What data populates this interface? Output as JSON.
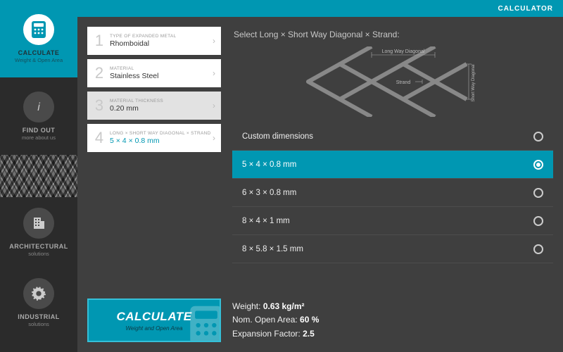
{
  "header": {
    "title": "CALCULATOR"
  },
  "sidebar": {
    "items": [
      {
        "title": "CALCULATE",
        "sub": "Weight & Open Area"
      },
      {
        "title": "FIND OUT",
        "sub": "more about us"
      },
      {
        "title": "ARCHITECTURAL",
        "sub": "solutions"
      },
      {
        "title": "INDUSTRIAL",
        "sub": "solutions"
      }
    ]
  },
  "steps": [
    {
      "num": "1",
      "label": "TYPE OF EXPANDED METAL",
      "value": "Rhomboidal"
    },
    {
      "num": "2",
      "label": "MATERIAL",
      "value": "Stainless Steel"
    },
    {
      "num": "3",
      "label": "MATERIAL THICKNESS",
      "value": "0.20 mm"
    },
    {
      "num": "4",
      "label": "LONG × SHORT WAY DIAGONAL × STRAND",
      "value": "5 × 4 × 0.8 mm"
    }
  ],
  "panel": {
    "title": "Select Long × Short Way Diagonal × Strand:",
    "diagram_labels": {
      "long": "Long Way Diagonal",
      "short": "Short Way Diagonal",
      "strand": "Strand"
    },
    "options": [
      {
        "label": "Custom dimensions",
        "selected": false
      },
      {
        "label": "5 × 4 × 0.8 mm",
        "selected": true
      },
      {
        "label": "6 × 3 × 0.8 mm",
        "selected": false
      },
      {
        "label": "8 × 4 × 1 mm",
        "selected": false
      },
      {
        "label": "8 × 5.8 × 1.5 mm",
        "selected": false
      }
    ]
  },
  "footer": {
    "button": {
      "big": "CALCULATE",
      "small": "Weight and Open Area"
    },
    "results": {
      "weight_label": "Weight: ",
      "weight_value": "0.63 kg/m²",
      "openarea_label": "Nom. Open Area: ",
      "openarea_value": "60 %",
      "expansion_label": "Expansion Factor: ",
      "expansion_value": "2.5"
    }
  },
  "colors": {
    "accent": "#0097b2"
  }
}
